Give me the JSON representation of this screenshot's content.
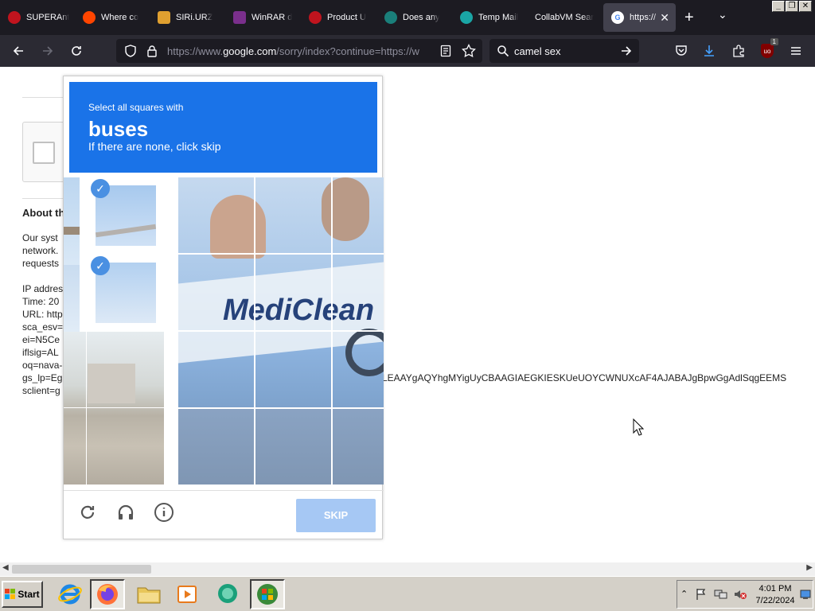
{
  "browser": {
    "tabs": [
      {
        "title": "SUPERAnt",
        "color": "#c0141e",
        "glyph": "●"
      },
      {
        "title": "Where co",
        "color": "#ff4500",
        "glyph": "●"
      },
      {
        "title": "SIRi.URZ",
        "color": "#e0a030",
        "glyph": "■"
      },
      {
        "title": "WinRAR d",
        "color": "#7a2f8c",
        "glyph": "■"
      },
      {
        "title": "Product U",
        "color": "#c0141e",
        "glyph": "●"
      },
      {
        "title": "Does any",
        "color": "#1a7f7a",
        "glyph": "●"
      },
      {
        "title": "Temp Mail",
        "color": "#1aa5a5",
        "glyph": "●"
      },
      {
        "title": "CollabVM Sear",
        "color": "#1c1b22",
        "glyph": ""
      },
      {
        "title": "https://",
        "color": "#ffffff",
        "glyph": "G",
        "active": true
      }
    ],
    "url": {
      "prefix": "https://www.",
      "domain": "google.com",
      "rest": "/sorry/index?continue=https://w"
    },
    "search_value": "camel sex",
    "download_badge": "1"
  },
  "page": {
    "about_heading": "About th",
    "body_lines": [
      "Our syst",
      "network.",
      "requests"
    ],
    "ip_line": "IP addres",
    "time_line": "Time: 20",
    "url_line": "URL: http",
    "param_lines": [
      "sca_esv=",
      "ei=N5Ce",
      "iflsig=AL",
      "oq=nava-",
      "gs_lp=Eg",
      "sclient=g"
    ],
    "long_tail": "LEAAYgAQYhgMYigUyCBAAGIAEGKIESKUeUOYCWNUXcAF4AJABAJgBpwGgAdlSqgEEMS"
  },
  "captcha": {
    "instruction": "Select all squares with",
    "target_word": "buses",
    "hint": "If there are none, click skip",
    "tile_image_text": "MediClean",
    "skip_label": "SKIP",
    "accent": "#1a73e8"
  },
  "taskbar": {
    "start_label": "Start",
    "time": "4:01 PM",
    "date": "7/22/2024"
  }
}
